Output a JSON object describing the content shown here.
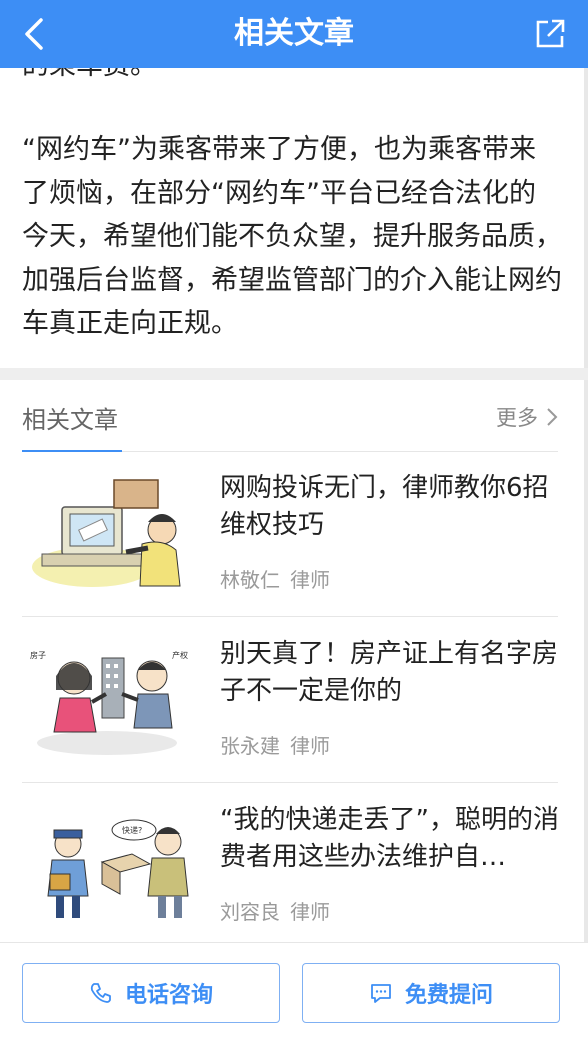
{
  "header": {
    "title": "相关文章",
    "back_icon": "chevron-left-icon",
    "share_icon": "share-external-icon",
    "bg_color": "#3d8ef5"
  },
  "article": {
    "prev_line": "的乘车费。",
    "paragraph": "“网约车”为乘客带来了方便，也为乘客带来了烦恼，在部分“网约车”平台已经合法化的今天，希望他们能不负众望，提升服务品质，加强后台监督，希望监管部门的介入能让网约车真正走向正规。"
  },
  "related": {
    "label": "相关文章",
    "more_label": "更多",
    "items": [
      {
        "title": "网购投诉无门，律师教你6招维权技巧",
        "author": "林敬仁",
        "role": "律师",
        "thumb": "cartoon-online-shopping"
      },
      {
        "title": "别天真了！房产证上有名字房子不一定是你的",
        "author": "张永建",
        "role": "律师",
        "thumb": "cartoon-property-dispute"
      },
      {
        "title": "“我的快递走丢了”，聪明的消费者用这些办法维护自…",
        "author": "刘容良",
        "role": "律师",
        "thumb": "cartoon-lost-package"
      }
    ]
  },
  "actions": {
    "call_label": "电话咨询",
    "call_icon": "phone-icon",
    "ask_label": "免费提问",
    "ask_icon": "chat-bubble-icon",
    "accent_color": "#3d8ef5"
  }
}
